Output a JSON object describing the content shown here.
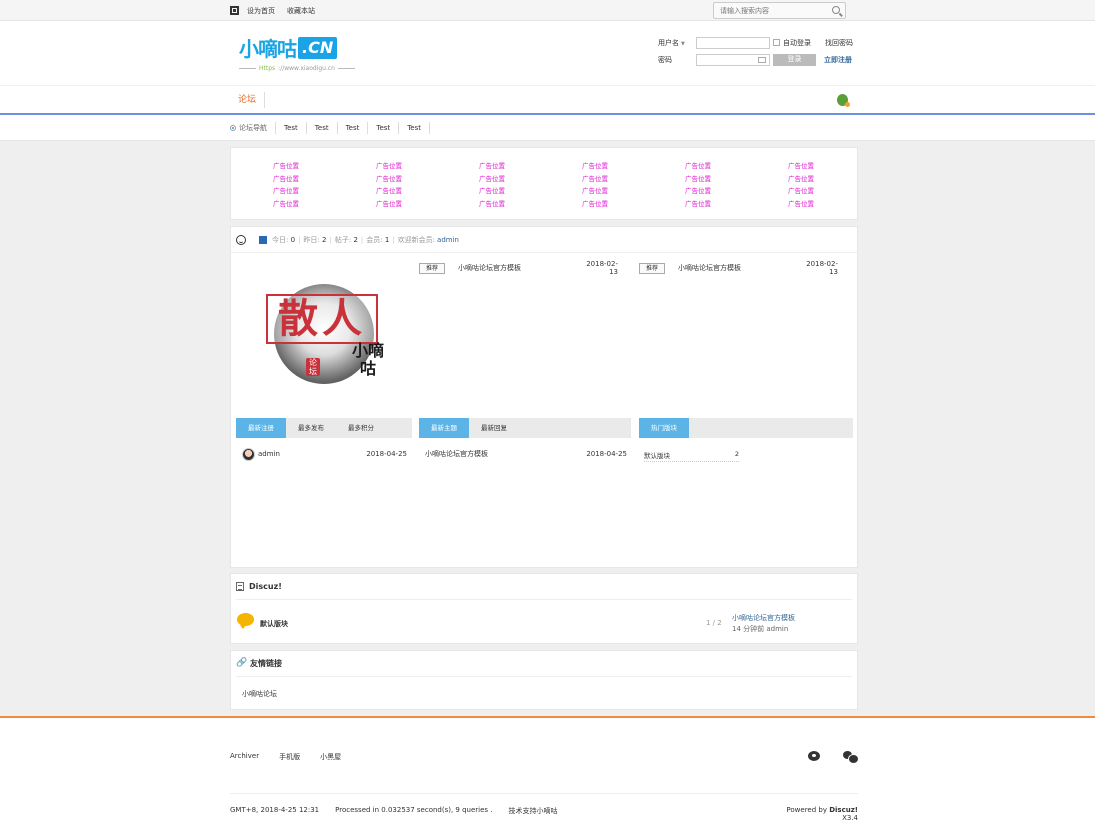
{
  "topbar": {
    "set_home": "设为首页",
    "bookmark": "收藏本站",
    "search_placeholder": "请输入搜索内容"
  },
  "header": {
    "logo_main": "小嘀咕",
    "logo_badge": ".CN",
    "logo_proto": "Https",
    "logo_url": "://www.xiaodigu.cn",
    "login": {
      "username_label": "用户名",
      "password_label": "密码",
      "auto_login": "自动登录",
      "forgot_password": "找回密码",
      "login_button": "登录",
      "register": "立即注册"
    }
  },
  "nav": {
    "items": [
      "论坛"
    ]
  },
  "subnav": {
    "items": [
      "论坛导航",
      "Test",
      "Test",
      "Test",
      "Test",
      "Test"
    ]
  },
  "ads": {
    "cells": [
      "广告位置",
      "广告位置",
      "广告位置",
      "广告位置",
      "广告位置",
      "广告位置",
      "广告位置",
      "广告位置",
      "广告位置",
      "广告位置",
      "广告位置",
      "广告位置",
      "广告位置",
      "广告位置",
      "广告位置",
      "广告位置",
      "广告位置",
      "广告位置",
      "广告位置",
      "广告位置",
      "广告位置",
      "广告位置",
      "广告位置",
      "广告位置"
    ]
  },
  "stats": {
    "today_label": "今日:",
    "today": "0",
    "yesterday_label": "昨日:",
    "yesterday": "2",
    "posts_label": "帖子:",
    "posts": "2",
    "members_label": "会员:",
    "members": "1",
    "newest_label": "欢迎新会员:",
    "newest_user": "admin"
  },
  "portal_logo": {
    "big": "散人",
    "small": "小嘀咕",
    "seal": "论坛"
  },
  "recommend": {
    "left": {
      "button": "推荐",
      "title": "小嘀咕论坛官方模板",
      "date": "2018-02-13"
    },
    "right": {
      "button": "推荐",
      "title": "小嘀咕论坛官方模板",
      "date": "2018-02-13"
    }
  },
  "tabs": {
    "members": [
      "最新注册",
      "最多发布",
      "最多积分"
    ],
    "threads": [
      "最新主题",
      "最新回复"
    ],
    "boards": [
      "热门版块"
    ]
  },
  "lists": {
    "member": {
      "name": "admin",
      "date": "2018-04-25"
    },
    "thread": {
      "title": "小嘀咕论坛官方模板",
      "date": "2018-04-25"
    },
    "board": {
      "name": "默认版块",
      "count": "2"
    }
  },
  "forum": {
    "section_title": "Discuz!",
    "board_name": "默认版块",
    "count": "1 / 2",
    "last_post": "小嘀咕论坛官方模板",
    "last_meta": "14 分钟前 admin"
  },
  "links": {
    "section_title": "友情链接",
    "items": [
      "小嘀咕论坛"
    ]
  },
  "footer": {
    "links": [
      "Archiver",
      "手机版",
      "小黑屋"
    ],
    "time": "GMT+8, 2018-4-25 12:31",
    "processed": "Processed in 0.032537 second(s), 9 queries .",
    "support": "技术支持小嘀咕",
    "powered_prefix": "Powered by",
    "powered_brand": "Discuz!",
    "powered_version": "X3.4"
  },
  "colors": {
    "accent_blue": "#1aa4e6",
    "tab_blue": "#5bb4e5",
    "nav_orange": "#e96c2a",
    "ad_magenta": "#e01bd0",
    "footer_orange": "#f08a40",
    "seal_red": "#c9323a"
  },
  "icons": {
    "topbar": "qr-code-icon",
    "search": "search-icon",
    "stats": [
      "smile-icon",
      "chart-icon"
    ],
    "forum": "doc-icon",
    "board": "speech-bubble-icon",
    "links": "link-icon",
    "footer": [
      "weibo-icon",
      "wechat-icon"
    ]
  }
}
